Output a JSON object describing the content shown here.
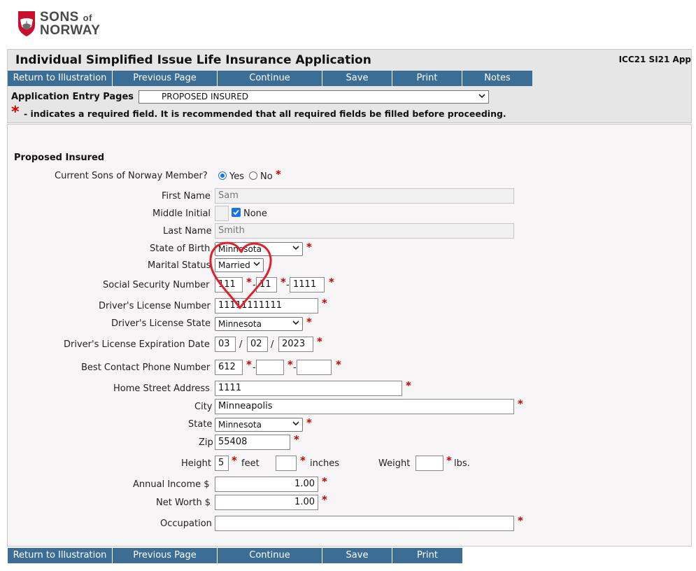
{
  "logo": {
    "line1": "SONS",
    "line1_small": "of",
    "line2": "NORWAY"
  },
  "header": {
    "title": "Individual Simplified Issue Life Insurance Application",
    "form_code": "ICC21 SI21 App"
  },
  "nav_top": {
    "return": "Return to Illustration",
    "previous": "Previous Page",
    "continue": "Continue",
    "save": "Save",
    "print": "Print",
    "notes": "Notes"
  },
  "nav_bottom": {
    "return": "Return to Illustration",
    "previous": "Previous Page",
    "continue": "Continue",
    "save": "Save",
    "print": "Print"
  },
  "entry": {
    "label": "Application Entry Pages",
    "selected": "PROPOSED INSURED"
  },
  "required_note": "- indicates a required field. It is recommended that all required fields be filled before proceeding.",
  "required_mark": "*",
  "section_title": "Proposed Insured",
  "form": {
    "member": {
      "label": "Current Sons of Norway Member?",
      "yes": "Yes",
      "no": "No"
    },
    "first_name": {
      "label": "First Name",
      "value": "Sam"
    },
    "middle_initial": {
      "label": "Middle Initial",
      "value": "",
      "none_label": "None"
    },
    "last_name": {
      "label": "Last Name",
      "value": "Smith"
    },
    "state_of_birth": {
      "label": "State of Birth",
      "value": "Minnesota"
    },
    "marital_status": {
      "label": "Marital Status",
      "value": "Married"
    },
    "ssn": {
      "label": "Social Security Number",
      "part1": "111",
      "part2": "11",
      "part3": "1111",
      "sep": "-"
    },
    "dl_number": {
      "label": "Driver's License Number",
      "value": "11111111111"
    },
    "dl_state": {
      "label": "Driver's License State",
      "value": "Minnesota"
    },
    "dl_exp": {
      "label": "Driver's License Expiration Date",
      "month": "03",
      "day": "02",
      "year": "2023",
      "sep": "/"
    },
    "phone": {
      "label": "Best Contact Phone Number",
      "area": "612",
      "prefix": "",
      "line": "",
      "sep": "-"
    },
    "street": {
      "label": "Home Street Address",
      "value": "1111"
    },
    "city": {
      "label": "City",
      "value": "Minneapolis"
    },
    "state": {
      "label": "State",
      "value": "Minnesota"
    },
    "zip": {
      "label": "Zip",
      "value": "55408"
    },
    "height": {
      "label": "Height",
      "feet": "5",
      "feet_unit": "feet",
      "inches": "",
      "inches_unit": "inches"
    },
    "weight": {
      "label": "Weight",
      "value": "",
      "unit": "lbs."
    },
    "income": {
      "label": "Annual Income $",
      "value": "1.00"
    },
    "net_worth": {
      "label": "Net Worth $",
      "value": "1.00"
    },
    "occupation": {
      "label": "Occupation",
      "value": ""
    }
  },
  "colors": {
    "button": "#3b6d95",
    "required": "#cc0000",
    "annotation": "#e0202a"
  }
}
